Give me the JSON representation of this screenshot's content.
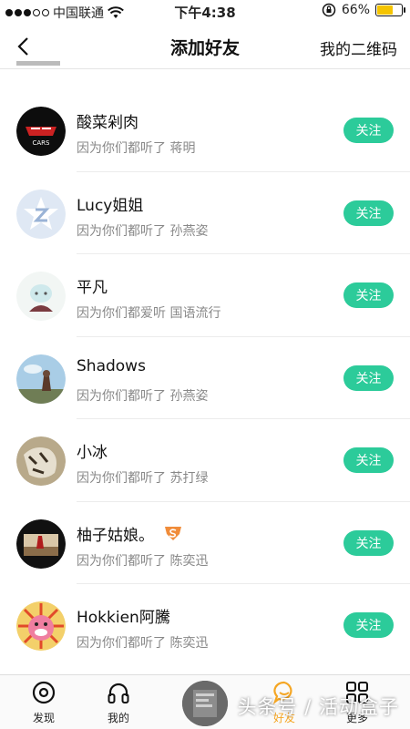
{
  "status": {
    "carrier": "中国联通",
    "time": "下午4:38",
    "battery": "66%",
    "battery_level": 0.66
  },
  "nav": {
    "title": "添加好友",
    "right_action": "我的二维码"
  },
  "list": [
    {
      "name": "酸菜剁肉",
      "reason": "因为你们都听了 蒋明",
      "action": "关注",
      "badge": false
    },
    {
      "name": "Lucy姐姐",
      "reason": "因为你们都听了 孙燕姿",
      "action": "关注",
      "badge": false
    },
    {
      "name": "平凡",
      "reason": "因为你们都爱听 国语流行",
      "action": "关注",
      "badge": false
    },
    {
      "name": "Shadows",
      "reason": "因为你们都听了 孙燕姿",
      "action": "关注",
      "badge": false
    },
    {
      "name": "小冰",
      "reason": "因为你们都听了 苏打绿",
      "action": "关注",
      "badge": false
    },
    {
      "name": "柚子姑娘。",
      "reason": "因为你们都听了 陈奕迅",
      "action": "关注",
      "badge": true
    },
    {
      "name": "Hokkien阿騰",
      "reason": "因为你们都听了 陈奕迅",
      "action": "关注",
      "badge": false
    }
  ],
  "tabs": {
    "discover": "发现",
    "mine": "我的",
    "friends": "好友",
    "more": "更多"
  },
  "watermark": "头条号 / 活动盒子",
  "colors": {
    "accent": "#2ccb9a",
    "tab_active": "#f5a623",
    "badge": "#f08c3a"
  }
}
